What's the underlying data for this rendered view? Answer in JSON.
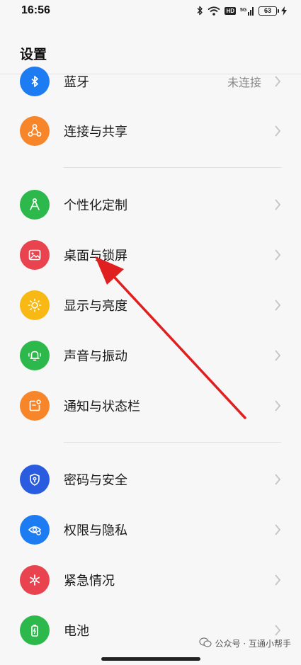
{
  "status_bar": {
    "time": "16:56",
    "hd": "HD",
    "signal_text": "5G",
    "battery": "63"
  },
  "page": {
    "title": "设置"
  },
  "items": [
    {
      "label": "蓝牙",
      "value": "未连接",
      "icon": "bluetooth-icon",
      "color": "#1E7CF2"
    },
    {
      "label": "连接与共享",
      "icon": "share-icon",
      "color": "#F7862A"
    },
    {
      "label": "个性化定制",
      "icon": "compass-icon",
      "color": "#2DB84C"
    },
    {
      "label": "桌面与锁屏",
      "icon": "image-icon",
      "color": "#E8434F"
    },
    {
      "label": "显示与亮度",
      "icon": "sun-icon",
      "color": "#F9B914"
    },
    {
      "label": "声音与振动",
      "icon": "bell-icon",
      "color": "#2DB84C"
    },
    {
      "label": "通知与状态栏",
      "icon": "notification-icon",
      "color": "#F7862A"
    },
    {
      "label": "密码与安全",
      "icon": "shield-icon",
      "color": "#2A5CE0"
    },
    {
      "label": "权限与隐私",
      "icon": "eye-icon",
      "color": "#1E7CF2"
    },
    {
      "label": "紧急情况",
      "icon": "asterisk-icon",
      "color": "#E8434F"
    },
    {
      "label": "电池",
      "icon": "battery-icon",
      "color": "#2DB84C"
    }
  ],
  "watermark": {
    "text": "公众号 · 互通小帮手"
  },
  "annotation": {
    "arrow_color": "#E02020"
  }
}
